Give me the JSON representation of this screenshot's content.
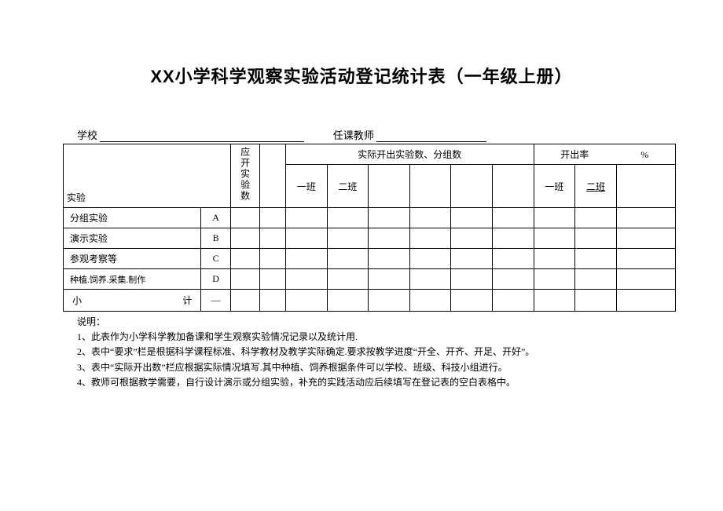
{
  "title": "XX小学科学观察实验活动登记统计表（一年级上册）",
  "header": {
    "school_label": "学校",
    "teacher_label": "任课教师"
  },
  "table": {
    "col_required": "应开实验数",
    "col_actual": "实际开出实验数、分组数",
    "col_rate": "开出率",
    "col_rate_unit": "%",
    "class1": "一班",
    "class2": "二班",
    "class1b": "一班",
    "class2b": "二班",
    "row_lab": "实验",
    "rows": [
      {
        "name": "分组实验",
        "code": "A"
      },
      {
        "name": "演示实验",
        "code": "B"
      },
      {
        "name": "参观考察等",
        "code": "C"
      },
      {
        "name": "种植.饲养.采集.制作",
        "code": "D"
      }
    ],
    "subtotal_a": "小",
    "subtotal_b": "计",
    "dash": "—"
  },
  "notes": {
    "heading": "说明：",
    "items": [
      "1、此表作为小学科学教加备课和学生观察实验情况记录以及统计用.",
      "2、表中“要求”栏是根据科学课程标准、科学教材及教学实际确定.要求按教学进度“开全、开齐、开足、开好”。",
      "3、表中“实际开出数”栏应根据实际情况填写.其中种植、饲养根据条件可以学校、班级、科技小组进行。",
      "4、教师可根据教学需要，自行设计演示或分组实验，补充的实践活动应后续填写在登记表的空白表格中。"
    ]
  }
}
